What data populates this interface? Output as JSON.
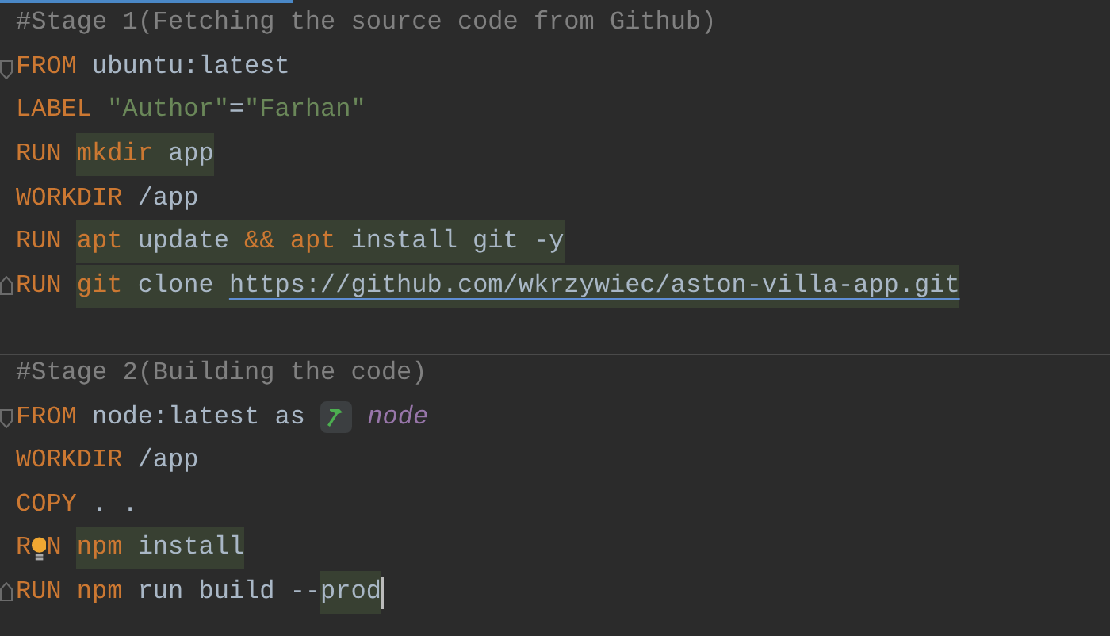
{
  "editor": {
    "lines": [
      {
        "tokens": [
          {
            "kind": "comment",
            "text": "#Stage 1(Fetching the source code from Github)"
          }
        ]
      },
      {
        "fold_start": true,
        "tokens": [
          {
            "kind": "keyword",
            "text": "FROM "
          },
          {
            "kind": "plain",
            "text": "ubuntu:latest"
          }
        ]
      },
      {
        "tokens": [
          {
            "kind": "keyword",
            "text": "LABEL "
          },
          {
            "kind": "string",
            "text": "\"Author\""
          },
          {
            "kind": "plain",
            "text": "="
          },
          {
            "kind": "string",
            "text": "\"Farhan\""
          }
        ]
      },
      {
        "tokens": [
          {
            "kind": "keyword",
            "text": "RUN "
          },
          {
            "kind": "command",
            "text": "mkdir",
            "highlight": true
          },
          {
            "kind": "plain",
            "text": " app",
            "highlight": true
          }
        ]
      },
      {
        "tokens": [
          {
            "kind": "keyword",
            "text": "WORKDIR "
          },
          {
            "kind": "plain",
            "text": "/app"
          }
        ]
      },
      {
        "tokens": [
          {
            "kind": "keyword",
            "text": "RUN "
          },
          {
            "kind": "command",
            "text": "apt",
            "highlight": true
          },
          {
            "kind": "plain",
            "text": " update ",
            "highlight": true
          },
          {
            "kind": "command",
            "text": "&& apt",
            "highlight": true
          },
          {
            "kind": "plain",
            "text": " install git -y",
            "highlight": true
          }
        ]
      },
      {
        "fold_end": true,
        "tokens": [
          {
            "kind": "keyword",
            "text": "RUN "
          },
          {
            "kind": "command",
            "text": "git",
            "highlight": true
          },
          {
            "kind": "plain",
            "text": " clone ",
            "highlight": true
          },
          {
            "kind": "link",
            "text": "https://github.com/wkrzywiec/aston-villa-app.git",
            "highlight": true
          }
        ]
      },
      {
        "separator": true
      },
      {
        "tokens": [
          {
            "kind": "comment",
            "text": "#Stage 2(Building the code)"
          }
        ]
      },
      {
        "fold_start": true,
        "tokens": [
          {
            "kind": "keyword",
            "text": "FROM "
          },
          {
            "kind": "plain",
            "text": "node:latest as "
          },
          {
            "kind": "marker"
          },
          {
            "kind": "alias",
            "text": " node"
          }
        ]
      },
      {
        "tokens": [
          {
            "kind": "keyword",
            "text": "WORKDIR "
          },
          {
            "kind": "plain",
            "text": "/app"
          }
        ]
      },
      {
        "tokens": [
          {
            "kind": "keyword",
            "text": "COPY "
          },
          {
            "kind": "plain",
            "text": ". ."
          }
        ]
      },
      {
        "tokens": [
          {
            "kind": "keyword",
            "text": "R"
          },
          {
            "kind": "bulb"
          },
          {
            "kind": "keyword",
            "text": "N "
          },
          {
            "kind": "command",
            "text": "npm",
            "highlight": true
          },
          {
            "kind": "plain",
            "text": " install",
            "highlight": true
          }
        ]
      },
      {
        "fold_end": true,
        "caret": true,
        "tokens": [
          {
            "kind": "keyword",
            "text": "RUN "
          },
          {
            "kind": "command",
            "text": "npm"
          },
          {
            "kind": "plain",
            "text": " run build --"
          },
          {
            "kind": "plain",
            "text": "prod",
            "highlight": true
          }
        ]
      }
    ]
  }
}
